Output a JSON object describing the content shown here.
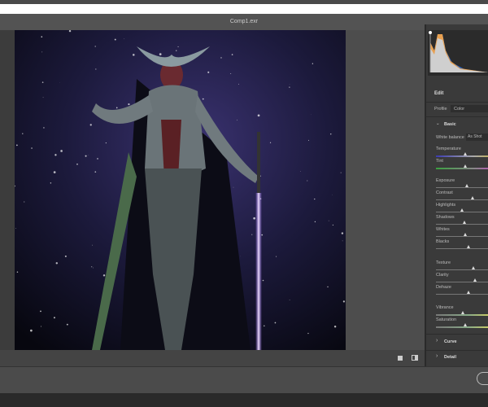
{
  "window": {
    "title": "Comp1.exr"
  },
  "panel": {
    "edit_label": "Edit",
    "profile_label": "Profile",
    "profile_value": "Color",
    "basic_label": "Basic",
    "white_balance_label": "White balance",
    "white_balance_value": "As Shot",
    "sliders": [
      {
        "label": "Temperature",
        "value": 0.55,
        "gradient": "temp"
      },
      {
        "label": "Tint",
        "value": 0.55,
        "gradient": "tint"
      },
      {
        "label": "Exposure",
        "value": 0.58
      },
      {
        "label": "Contrast",
        "value": 0.68
      },
      {
        "label": "Highlights",
        "value": 0.48
      },
      {
        "label": "Shadows",
        "value": 0.53
      },
      {
        "label": "Whites",
        "value": 0.55
      },
      {
        "label": "Blacks",
        "value": 0.6
      },
      {
        "label": "Texture",
        "value": 0.7
      },
      {
        "label": "Clarity",
        "value": 0.73
      },
      {
        "label": "Dehaze",
        "value": 0.6
      },
      {
        "label": "Vibrance",
        "value": 0.5,
        "gradient": "sat"
      },
      {
        "label": "Saturation",
        "value": 0.55,
        "gradient": "sat"
      }
    ],
    "curve_label": "Curve",
    "detail_label": "Detail"
  },
  "colors": {
    "temp_start": "#3a3ab0",
    "tint_start": "#3aa040",
    "accent": "#e8a050"
  }
}
